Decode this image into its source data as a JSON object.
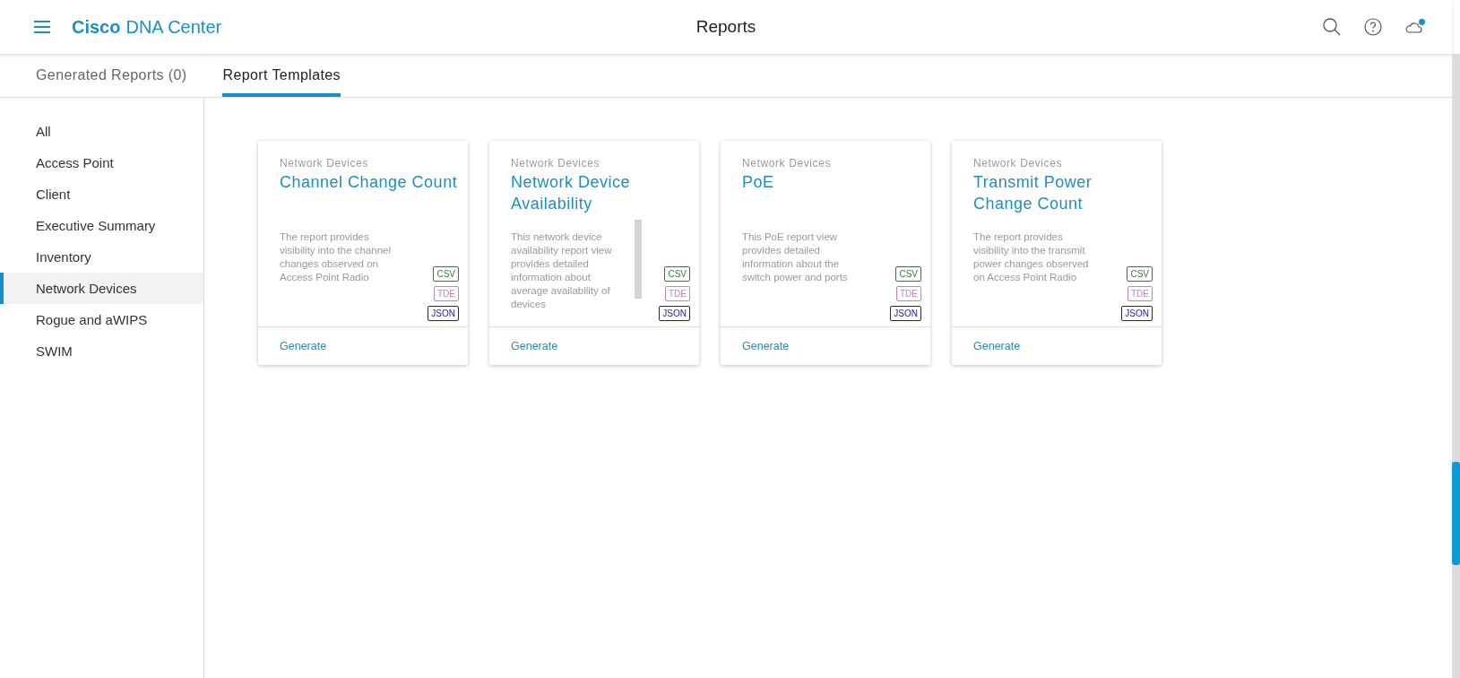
{
  "header": {
    "brand_bold": "Cisco",
    "brand": "DNA Center",
    "title": "Reports",
    "notification": true
  },
  "tabs": [
    {
      "label": "Generated Reports (0)",
      "selected": false
    },
    {
      "label": "Report Templates",
      "selected": true
    }
  ],
  "sidebar": {
    "items": [
      {
        "label": "All",
        "selected": false
      },
      {
        "label": "Access Point",
        "selected": false
      },
      {
        "label": "Client",
        "selected": false
      },
      {
        "label": "Executive Summary",
        "selected": false
      },
      {
        "label": "Inventory",
        "selected": false
      },
      {
        "label": "Network Devices",
        "selected": true
      },
      {
        "label": "Rogue and aWIPS",
        "selected": false
      },
      {
        "label": "SWIM",
        "selected": false
      }
    ]
  },
  "cards": [
    {
      "category": "Network Devices",
      "title": "Channel Change Count",
      "description": "The report provides visibility into the channel changes observed on Access Point Radio",
      "scrollable": false,
      "formats": [
        {
          "kind": "csv",
          "label": "CSV"
        },
        {
          "kind": "tde",
          "label": "TDE"
        },
        {
          "kind": "json",
          "label": "JSON"
        }
      ],
      "action": "Generate"
    },
    {
      "category": "Network Devices",
      "title": "Network Device Availability",
      "description": "This network device availability report view provides detailed information about average availability of devices",
      "scrollable": true,
      "formats": [
        {
          "kind": "csv",
          "label": "CSV"
        },
        {
          "kind": "tde",
          "label": "TDE"
        },
        {
          "kind": "json",
          "label": "JSON"
        }
      ],
      "action": "Generate"
    },
    {
      "category": "Network Devices",
      "title": "PoE",
      "description": "This PoE report view provides detailed information about the switch power and ports",
      "scrollable": false,
      "formats": [
        {
          "kind": "csv",
          "label": "CSV"
        },
        {
          "kind": "tde",
          "label": "TDE"
        },
        {
          "kind": "json",
          "label": "JSON"
        }
      ],
      "action": "Generate"
    },
    {
      "category": "Network Devices",
      "title": "Transmit Power Change Count",
      "description": "The report provides visibility into the transmit power changes observed on Access Point Radio",
      "scrollable": false,
      "formats": [
        {
          "kind": "csv",
          "label": "CSV"
        },
        {
          "kind": "tde",
          "label": "TDE"
        },
        {
          "kind": "json",
          "label": "JSON"
        }
      ],
      "action": "Generate"
    }
  ]
}
